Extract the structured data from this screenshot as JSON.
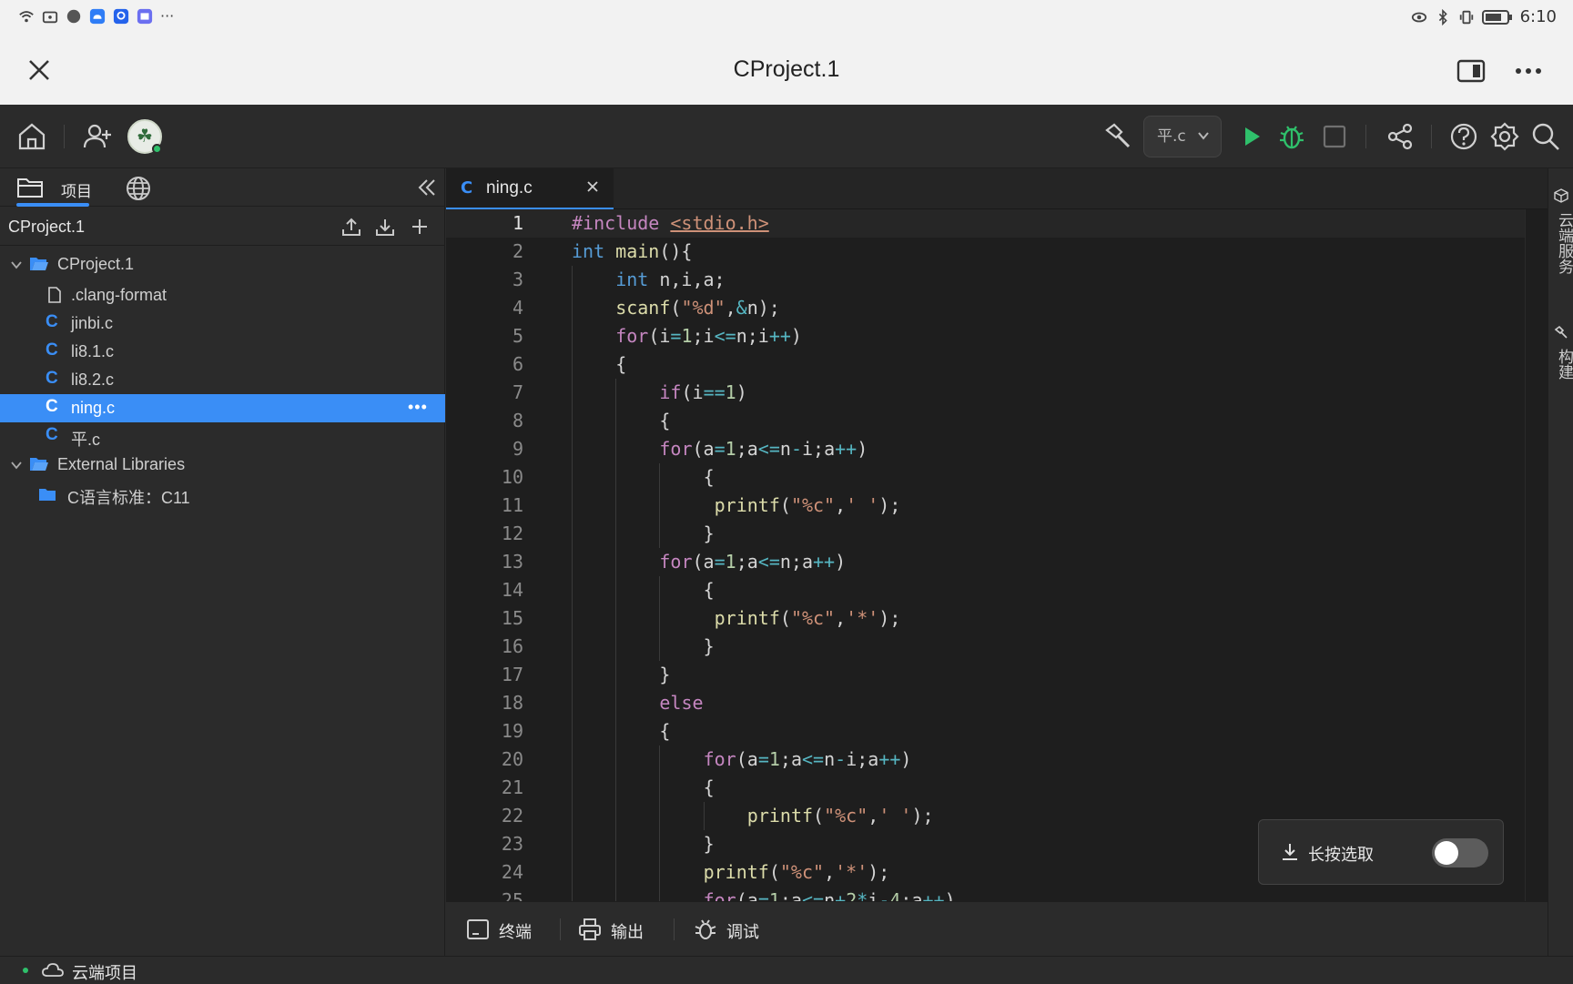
{
  "status_bar": {
    "time": "6:10"
  },
  "window": {
    "title": "CProject.1"
  },
  "toolbar": {
    "file_selector": "平.c"
  },
  "sidebar": {
    "tab_project": "项目",
    "project_name": "CProject.1",
    "tree": [
      {
        "label": "CProject.1",
        "kind": "folder-root"
      },
      {
        "label": ".clang-format",
        "kind": "file"
      },
      {
        "label": "jinbi.c",
        "kind": "c"
      },
      {
        "label": "li8.1.c",
        "kind": "c"
      },
      {
        "label": "li8.2.c",
        "kind": "c"
      },
      {
        "label": "ning.c",
        "kind": "c",
        "selected": true
      },
      {
        "label": "平.c",
        "kind": "c"
      },
      {
        "label": "External Libraries",
        "kind": "folder-root"
      },
      {
        "label": "C语言标准：C11",
        "kind": "folder"
      }
    ]
  },
  "editor": {
    "tab": {
      "icon": "C",
      "name": "ning.c"
    },
    "lines": [
      {
        "n": "1",
        "indent": 0,
        "html": "<span class='pp'>#include</span> <span class='inc'>&lt;stdio.h&gt;</span>"
      },
      {
        "n": "2",
        "indent": 0,
        "html": "<span class='kw'>int</span> <span class='fn'>main</span>(){"
      },
      {
        "n": "3",
        "indent": 1,
        "html": "<span class='kw'>int</span> n,i,a;"
      },
      {
        "n": "4",
        "indent": 1,
        "html": "<span class='fn'>scanf</span>(<span class='str'>\"%d\"</span>,<span class='op'>&amp;</span>n);"
      },
      {
        "n": "5",
        "indent": 1,
        "html": "<span class='pp'>for</span>(i<span class='op'>=</span><span class='num'>1</span>;i<span class='op'>&lt;=</span>n;i<span class='op'>++</span>)"
      },
      {
        "n": "6",
        "indent": 1,
        "html": "{"
      },
      {
        "n": "7",
        "indent": 2,
        "html": "<span class='pp'>if</span>(i<span class='op'>==</span><span class='num'>1</span>)"
      },
      {
        "n": "8",
        "indent": 2,
        "html": "{"
      },
      {
        "n": "9",
        "indent": 2,
        "html": "<span class='pp'>for</span>(a<span class='op'>=</span><span class='num'>1</span>;a<span class='op'>&lt;=</span>n<span class='op'>-</span>i;a<span class='op'>++</span>)"
      },
      {
        "n": "10",
        "indent": 3,
        "html": "{"
      },
      {
        "n": "11",
        "indent": 3,
        "html": " <span class='fn'>printf</span>(<span class='str'>\"%c\"</span>,<span class='str'>' '</span>);"
      },
      {
        "n": "12",
        "indent": 3,
        "html": "}"
      },
      {
        "n": "13",
        "indent": 2,
        "html": "<span class='pp'>for</span>(a<span class='op'>=</span><span class='num'>1</span>;a<span class='op'>&lt;=</span>n;a<span class='op'>++</span>)"
      },
      {
        "n": "14",
        "indent": 3,
        "html": "{"
      },
      {
        "n": "15",
        "indent": 3,
        "html": " <span class='fn'>printf</span>(<span class='str'>\"%c\"</span>,<span class='str'>'*'</span>);"
      },
      {
        "n": "16",
        "indent": 3,
        "html": "}"
      },
      {
        "n": "17",
        "indent": 2,
        "html": "}"
      },
      {
        "n": "18",
        "indent": 2,
        "html": "<span class='pp'>else</span>"
      },
      {
        "n": "19",
        "indent": 2,
        "html": "{"
      },
      {
        "n": "20",
        "indent": 3,
        "html": "<span class='pp'>for</span>(a<span class='op'>=</span><span class='num'>1</span>;a<span class='op'>&lt;=</span>n<span class='op'>-</span>i;a<span class='op'>++</span>)"
      },
      {
        "n": "21",
        "indent": 3,
        "html": "{"
      },
      {
        "n": "22",
        "indent": 4,
        "html": "<span class='fn'>printf</span>(<span class='str'>\"%c\"</span>,<span class='str'>' '</span>);"
      },
      {
        "n": "23",
        "indent": 3,
        "html": "}"
      },
      {
        "n": "24",
        "indent": 3,
        "html": "<span class='fn'>printf</span>(<span class='str'>\"%c\"</span>,<span class='str'>'*'</span>);"
      },
      {
        "n": "25",
        "indent": 3,
        "html": "<span class='pp'>for</span>(a<span class='op'>=</span><span class='num'>1</span>;a<span class='op'>&lt;=</span>n<span class='op'>+</span><span class='num'>2</span><span class='op'>*</span>i<span class='op'>-</span><span class='num'>4</span>;a<span class='op'>++</span>)"
      }
    ]
  },
  "right_panel": {
    "cloud_service": "云端服务",
    "build": "构建"
  },
  "popup": {
    "label": "长按选取",
    "toggle_on": false
  },
  "bottom_tabs": {
    "terminal": "终端",
    "output": "输出",
    "debug": "调试"
  },
  "statusbar": {
    "label": "云端项目"
  },
  "colors": {
    "accent": "#3a8ef6",
    "run": "#2fc06b",
    "background": "#1e1e1e",
    "panel": "#2b2b2b"
  },
  "icons": [
    "wifi-icon",
    "bluetooth-icon",
    "battery-icon",
    "close-icon",
    "home-icon",
    "add-user-icon",
    "hammer-icon",
    "run-icon",
    "debug-icon",
    "stop-icon",
    "share-icon",
    "help-icon",
    "settings-icon",
    "search-icon",
    "folder-icon",
    "globe-icon",
    "collapse-icon",
    "upload-icon",
    "download-icon",
    "plus-icon"
  ]
}
